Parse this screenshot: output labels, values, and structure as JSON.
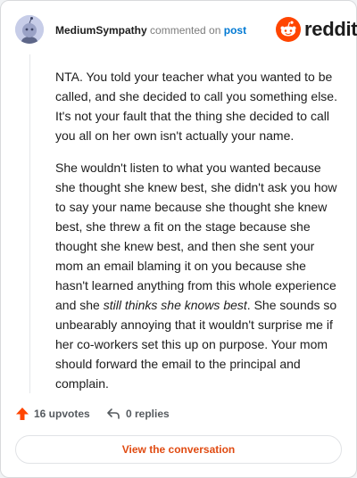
{
  "header": {
    "username": "MediumSympathy",
    "action_text": "commented on",
    "post_link": "post",
    "brand": "reddit"
  },
  "comment": {
    "paragraph1": "NTA. You told your teacher what you wanted to be called, and she decided to call you something else. It's not your fault that the thing she decided to call you all on her own isn't actually your name.",
    "paragraph2_before": "She wouldn't listen to what you wanted because she thought she knew best, she didn't ask you how to say your name because she thought she knew best, she threw a fit on the stage because she thought she knew best, and then she sent your mom an email blaming it on you because she hasn't learned anything from this whole experience and she ",
    "paragraph2_emphasis": "still thinks she knows best",
    "paragraph2_after": ". She sounds so unbearably annoying that it wouldn't surprise me if her co-workers set this up on purpose. Your mom should forward the email to the principal and complain."
  },
  "footer": {
    "upvotes": "16 upvotes",
    "replies": "0 replies",
    "cta": "View the conversation"
  },
  "colors": {
    "brand": "#ff4500",
    "link": "#0079d3",
    "cta_text": "#e04b12",
    "upvote": "#ff4500"
  },
  "icons": {
    "avatar": "snoo-avatar-icon",
    "brand_logo": "reddit-logo-icon",
    "upvote": "upvote-arrow-icon",
    "reply": "reply-arrow-icon"
  }
}
